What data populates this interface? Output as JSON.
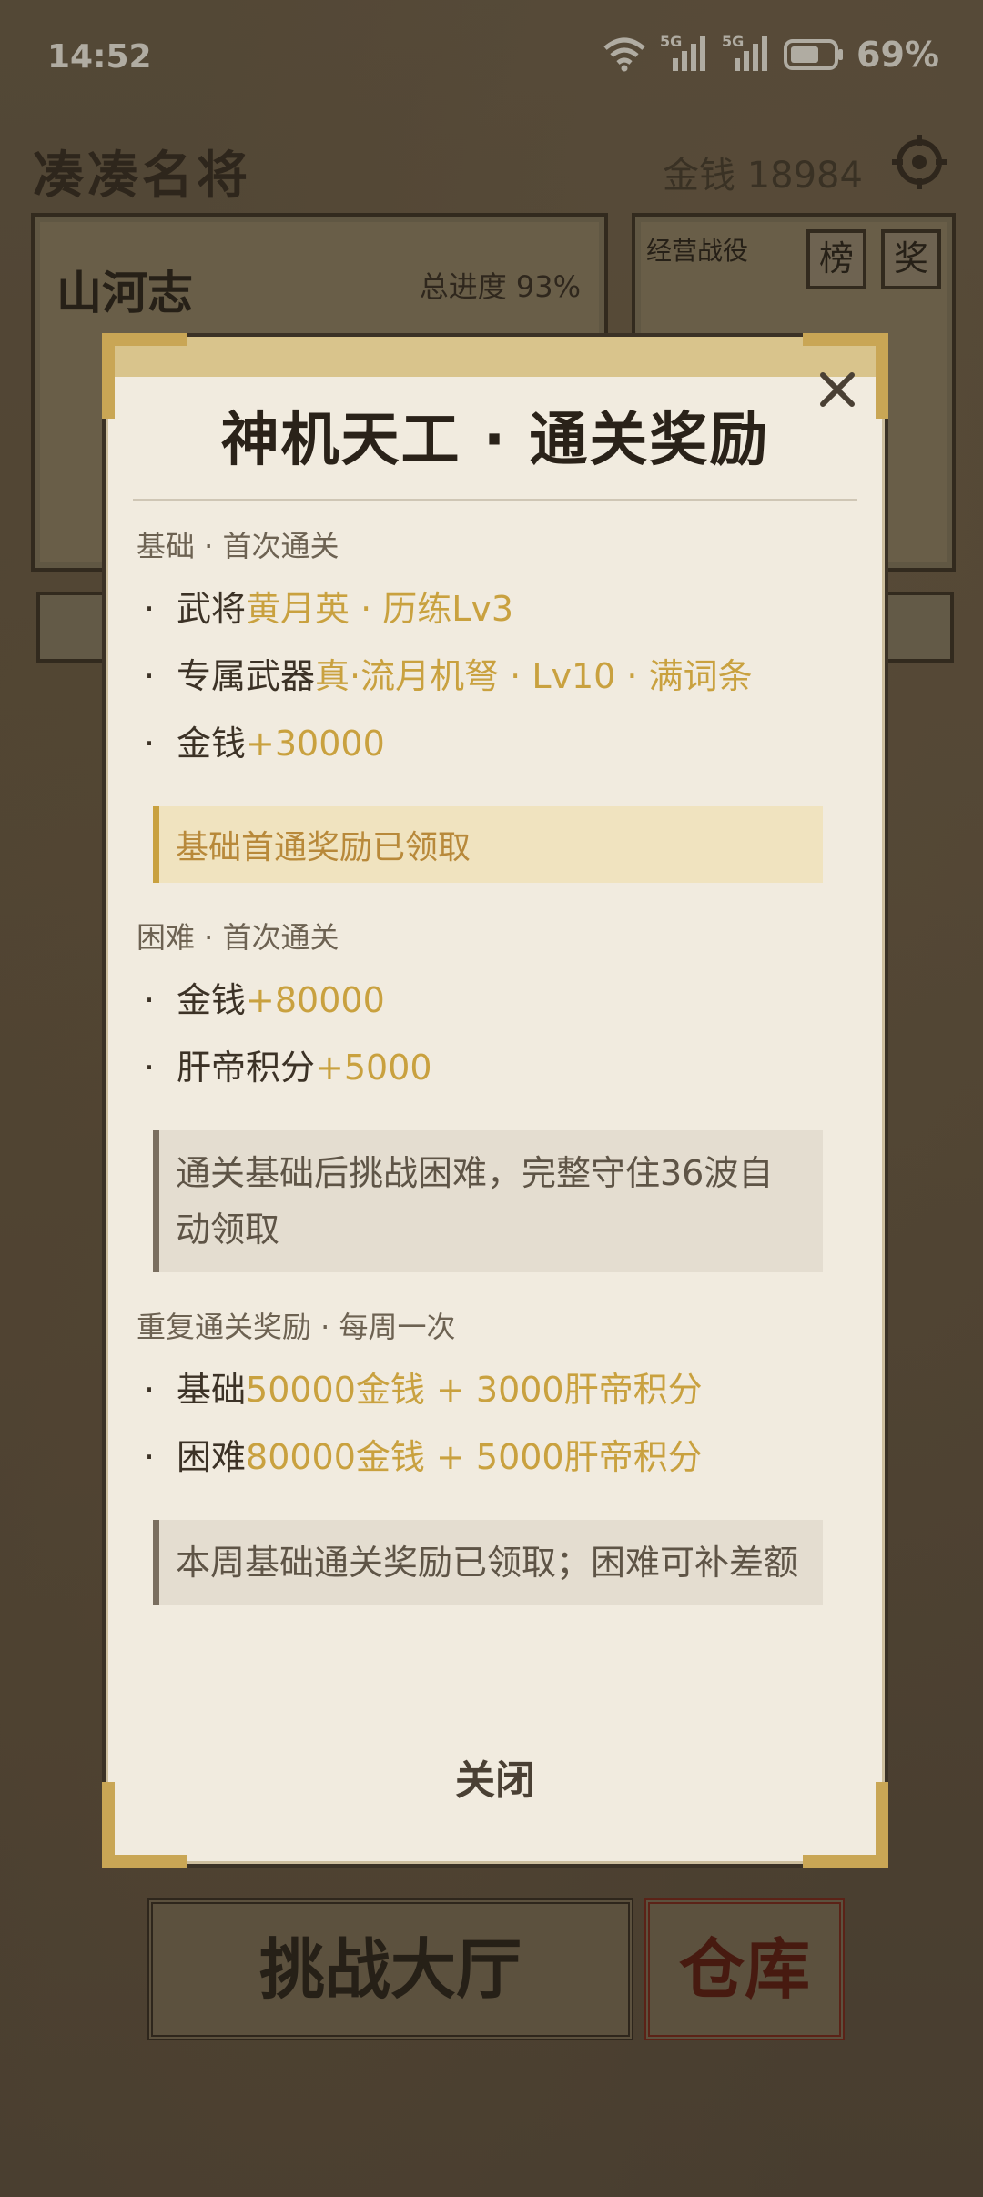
{
  "status_bar": {
    "time": "14:52",
    "network_1": "5G",
    "network_2": "5G",
    "battery": "69%"
  },
  "background": {
    "game_title": "凑凑名将",
    "money": "金钱 18984",
    "panel_a_title": "山河志",
    "panel_a_progress": "总进度 93%",
    "panel_b_label": "经营战役",
    "rank_button": "榜",
    "reward_button": "奖",
    "challenge_hall": "挑战大厅",
    "warehouse": "仓库"
  },
  "modal": {
    "title": "神机天工 · 通关奖励",
    "close_label": "关闭",
    "basic": {
      "title": "基础 · 首次通关",
      "items": [
        {
          "label": "武将",
          "value": "黄月英 · 历练Lv3"
        },
        {
          "label": "专属武器",
          "value": "真·流月机弩 · Lv10 · 满词条"
        },
        {
          "label": "金钱",
          "value": "+30000"
        }
      ],
      "note": "基础首通奖励已领取"
    },
    "hard": {
      "title": "困难 · 首次通关",
      "items": [
        {
          "label": "金钱",
          "value": "+80000"
        },
        {
          "label": "肝帝积分",
          "value": "+5000"
        }
      ],
      "note": "通关基础后挑战困难，完整守住36波自动领取"
    },
    "repeat": {
      "title": "重复通关奖励 · 每周一次",
      "items": [
        {
          "label": "基础",
          "value": "50000金钱 + 3000肝帝积分"
        },
        {
          "label": "困难",
          "value": "80000金钱 + 5000肝帝积分"
        }
      ],
      "note": "本周基础通关奖励已领取；困难可补差额"
    }
  },
  "colors": {
    "highlight": "#c9a13f",
    "parchment": "#f1ebdf",
    "gold_trim": "#c9a655"
  }
}
